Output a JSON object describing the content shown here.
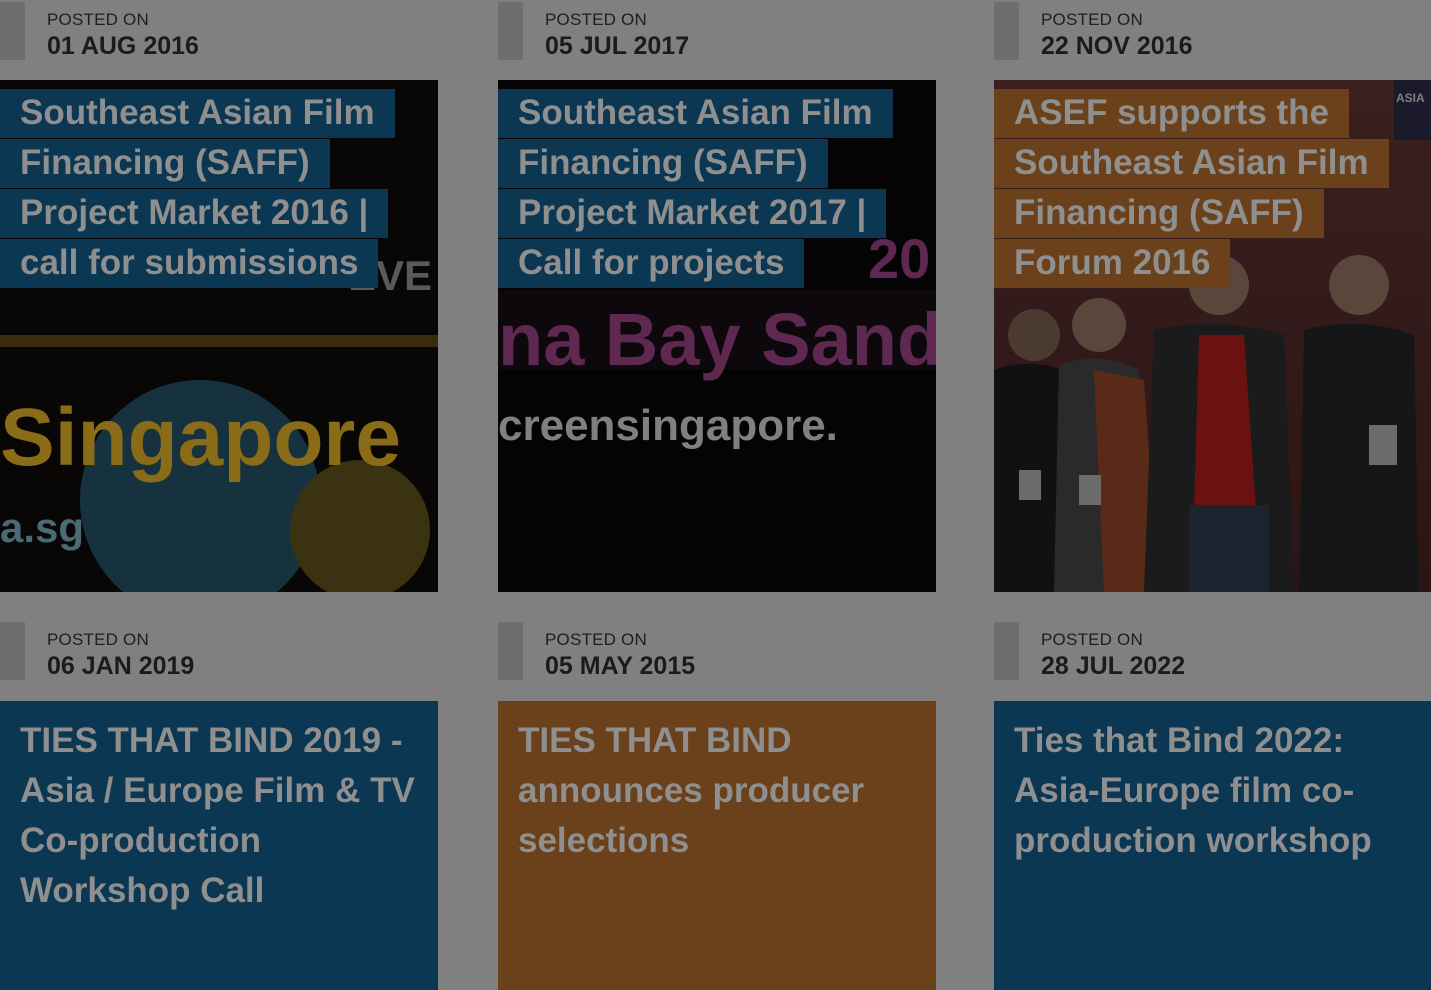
{
  "posts": [
    {
      "posted_label": "POSTED ON",
      "date": "01 AUG 2016",
      "title": "Southeast Asian Film Financing (SAFF) Project Market 2016 | call for submissions",
      "image_text": "Singapore",
      "image_subtext": "a.sg",
      "image_corner": "EVE"
    },
    {
      "posted_label": "POSTED ON",
      "date": "05 JUL 2017",
      "title": "Southeast Asian Film Financing (SAFF) Project Market 2017 | Call for projects",
      "image_text": "na Bay Sand",
      "image_subtext": "creensingapore.",
      "image_corner": "20"
    },
    {
      "posted_label": "POSTED ON",
      "date": "22 NOV 2016",
      "title": "ASEF supports the Southeast Asian Film Financing (SAFF) Forum 2016",
      "image_corner": "ASIA"
    },
    {
      "posted_label": "POSTED ON",
      "date": "06 JAN 2019",
      "title": "TIES THAT BIND 2019 - Asia / Europe Film & TV Co-production Workshop Call"
    },
    {
      "posted_label": "POSTED ON",
      "date": "05 MAY 2015",
      "title": "TIES THAT BIND announces producer selections"
    },
    {
      "posted_label": "POSTED ON",
      "date": "28 JUL 2022",
      "title": "Ties that Bind 2022: Asia-Europe film co-production workshop"
    }
  ],
  "colors": {
    "blue": "#0b3752",
    "orange": "#6b411c",
    "overlay": "#808080"
  }
}
